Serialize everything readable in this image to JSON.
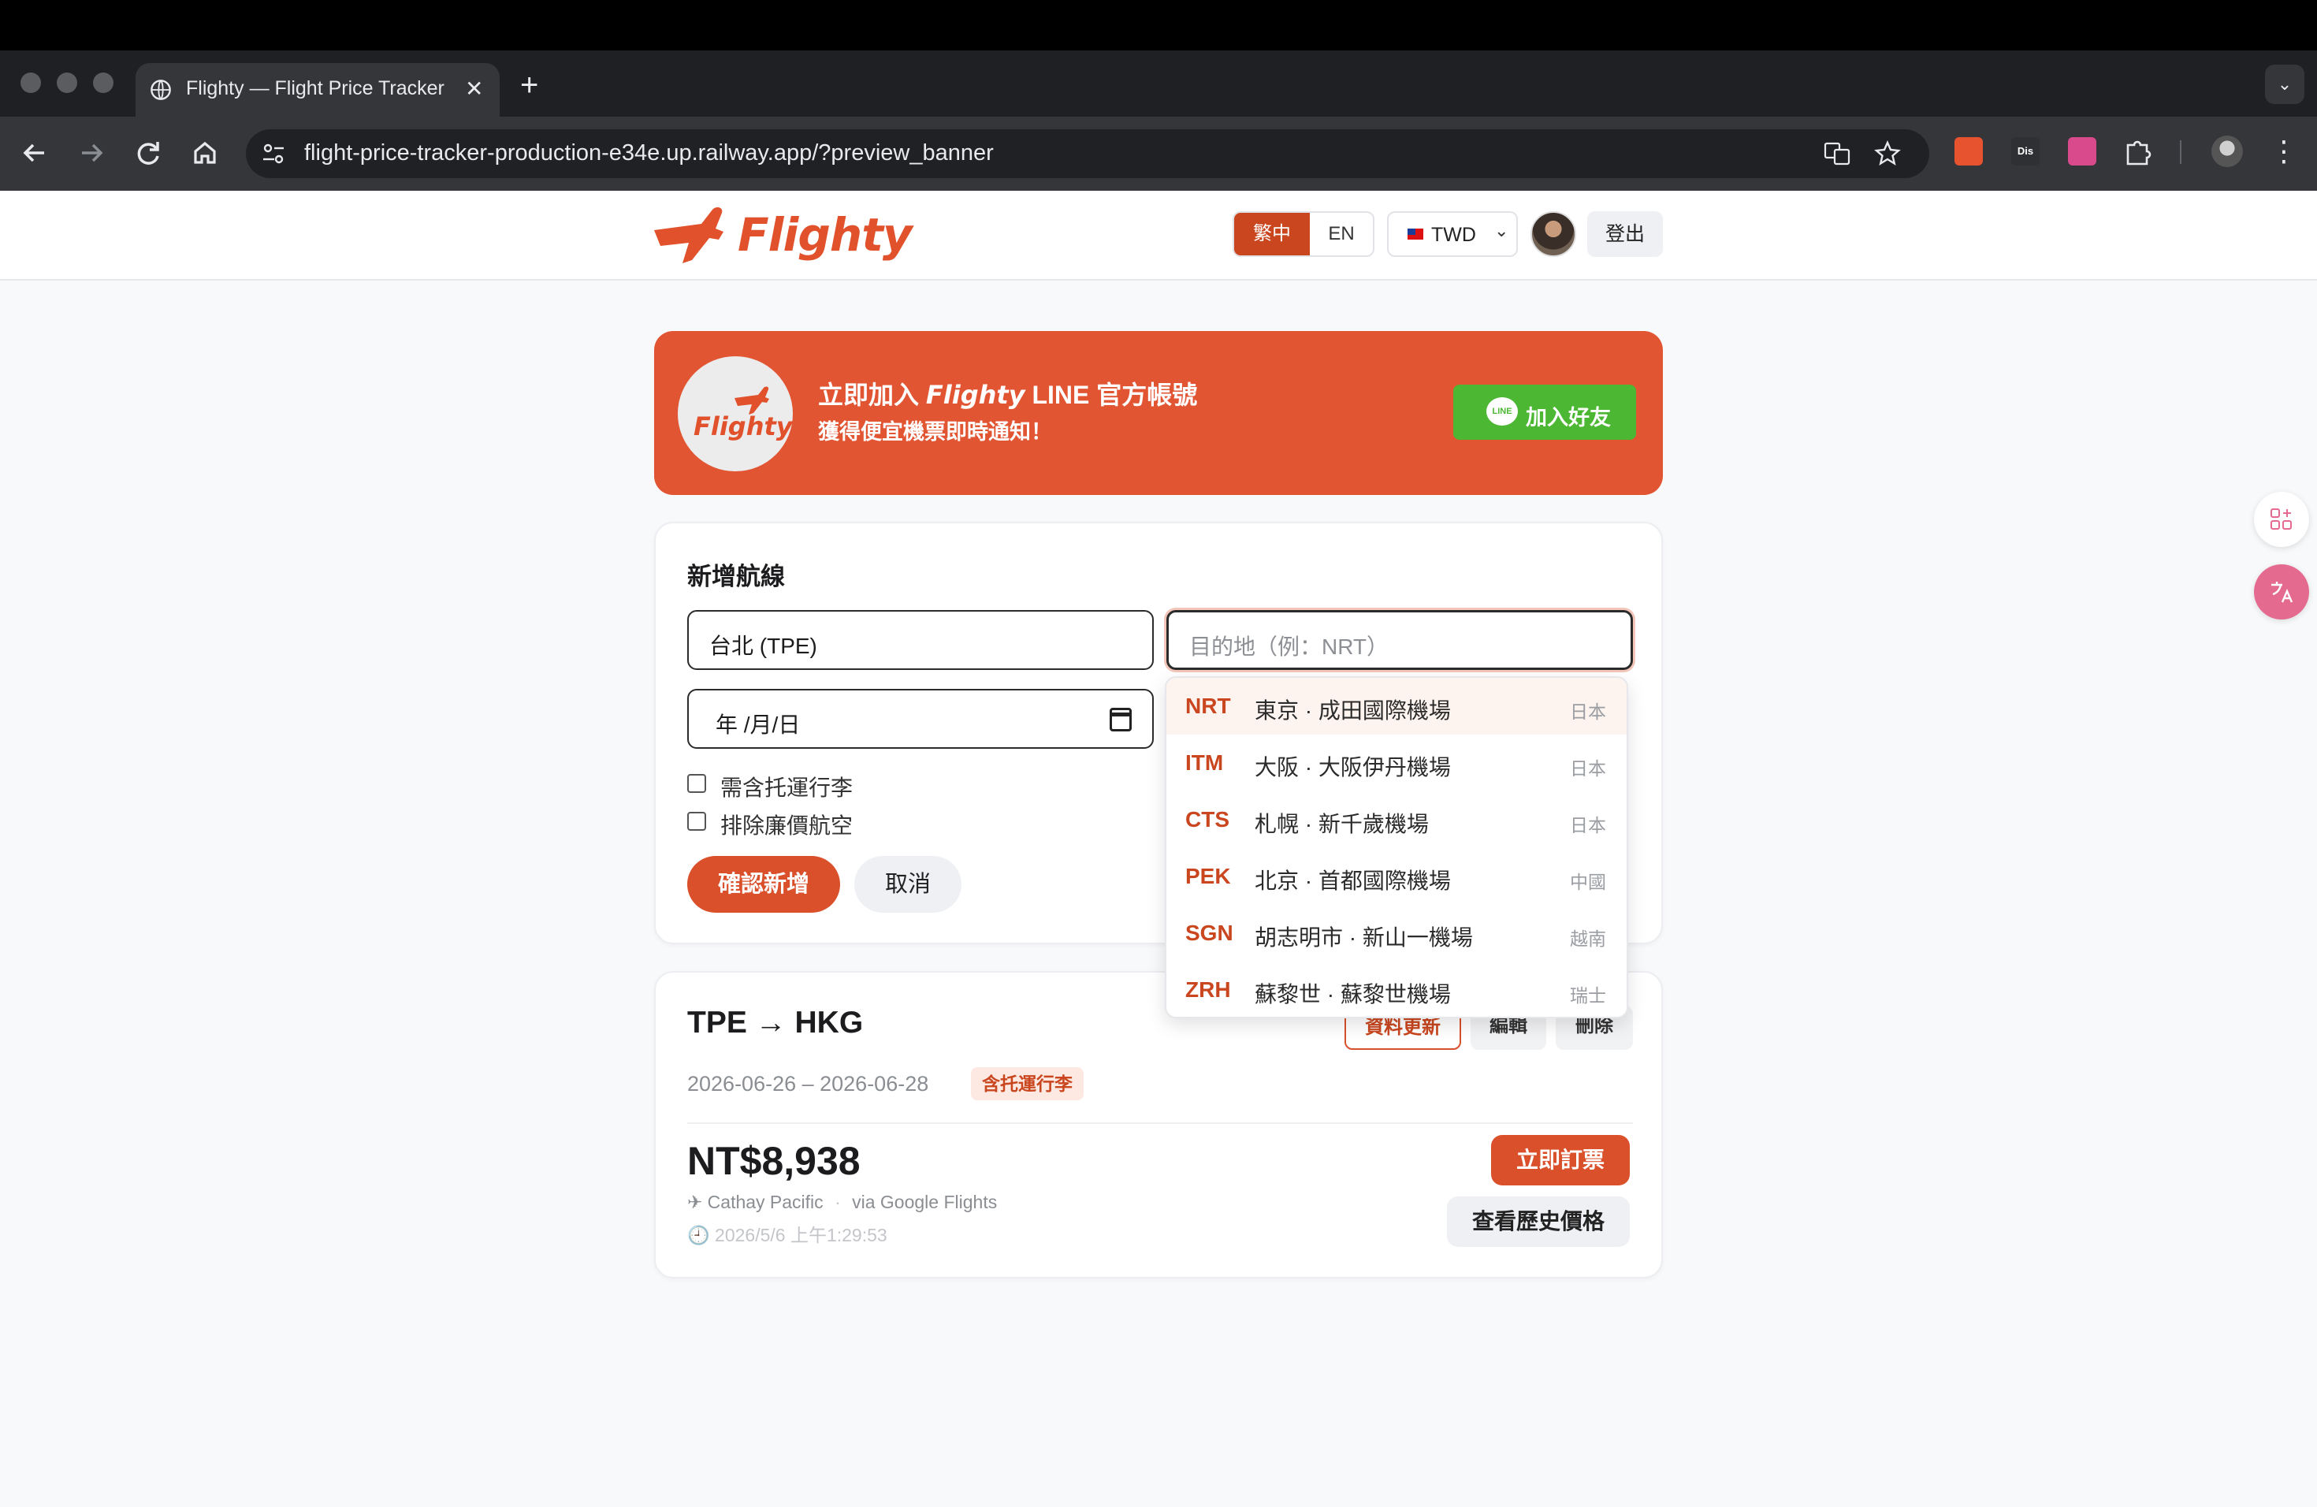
{
  "browser": {
    "tab_title": "Flighty — Flight Price Tracker",
    "tab_close": "✕",
    "new_tab": "+",
    "tab_menu": "⌄",
    "url": "flight-price-tracker-production-e34e.up.railway.app/?preview_banner",
    "extensions": [
      {
        "icon": "translate-ext-icon",
        "label": "",
        "color": "#e8532f"
      },
      {
        "icon": "dis-ext-icon",
        "label": "Dis",
        "color": "#2e3033"
      },
      {
        "icon": "language-ext-icon",
        "label": "",
        "color": "#d94a8c"
      }
    ],
    "menu": "⋮"
  },
  "header": {
    "logo_text": "Flighty",
    "lang_zh": "繁中",
    "lang_en": "EN",
    "currency": "TWD",
    "currency_caret": "⌄",
    "logout": "登出"
  },
  "banner": {
    "logo_text": "Flighty",
    "title_prefix": "立即加入",
    "title_brand": "Flighty",
    "title_suffix": "LINE 官方帳號",
    "subtitle": "獲得便宜機票即時通知！",
    "line_icon_text": "LINE",
    "button": "加入好友"
  },
  "add_route": {
    "title": "新增航線",
    "origin_value": "台北 (TPE)",
    "destination_placeholder": "目的地（例：NRT）",
    "date_value": "年 /月/日",
    "checkbox_baggage": "需含托運行李",
    "checkbox_no_lcc": "排除廉價航空",
    "confirm": "確認新增",
    "cancel": "取消"
  },
  "dropdown": {
    "items": [
      {
        "code": "NRT",
        "name": "東京 · 成田國際機場",
        "country": "日本"
      },
      {
        "code": "ITM",
        "name": "大阪 · 大阪伊丹機場",
        "country": "日本"
      },
      {
        "code": "CTS",
        "name": "札幌 · 新千歲機場",
        "country": "日本"
      },
      {
        "code": "PEK",
        "name": "北京 · 首都國際機場",
        "country": "中國"
      },
      {
        "code": "SGN",
        "name": "胡志明市 · 新山一機場",
        "country": "越南"
      },
      {
        "code": "ZRH",
        "name": "蘇黎世 · 蘇黎世機場",
        "country": "瑞士"
      }
    ]
  },
  "route_card": {
    "title": "TPE → HKG",
    "refresh": "資料更新",
    "edit": "編輯",
    "delete": "刪除",
    "dates": "2026-06-26 – 2026-06-28",
    "badge": "含托運行李",
    "price": "NT$8,938",
    "airline": "✈ Cathay Pacific",
    "source": "via Google Flights",
    "separator": "·",
    "updated": "🕘 2026/5/6 上午1:29:53",
    "book": "立即訂票",
    "history": "查看歷史價格"
  },
  "colors": {
    "brand": "#d9502b",
    "banner": "#e25533",
    "line_green": "#4cb733"
  }
}
